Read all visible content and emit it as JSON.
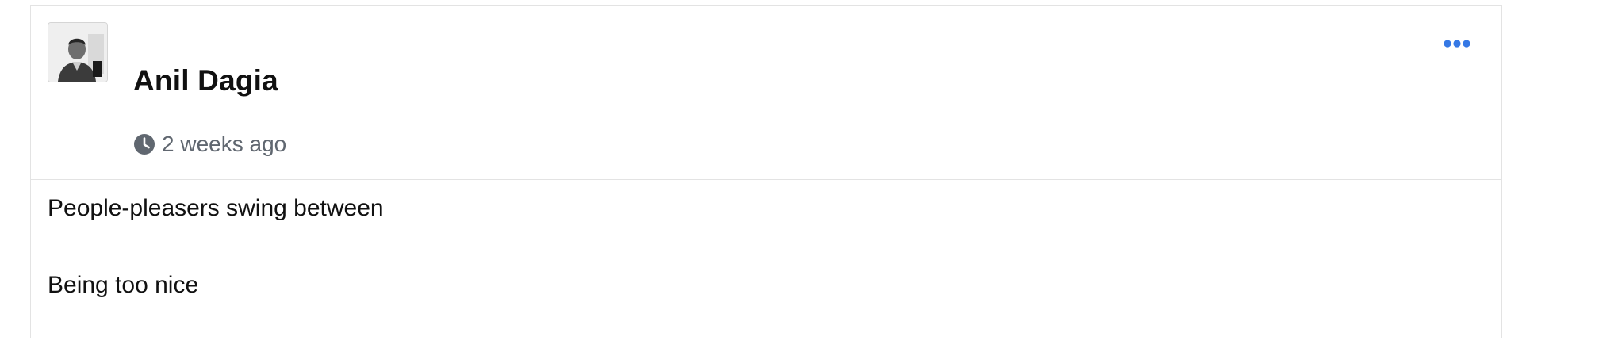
{
  "post": {
    "author_name": "Anil Dagia",
    "timestamp": "2 weeks ago",
    "more_icon": "more-horizontal-icon",
    "clock_icon": "clock-icon",
    "accent_color": "#3578e5",
    "body_lines": [
      "People-pleasers swing between",
      "Being too nice"
    ]
  }
}
